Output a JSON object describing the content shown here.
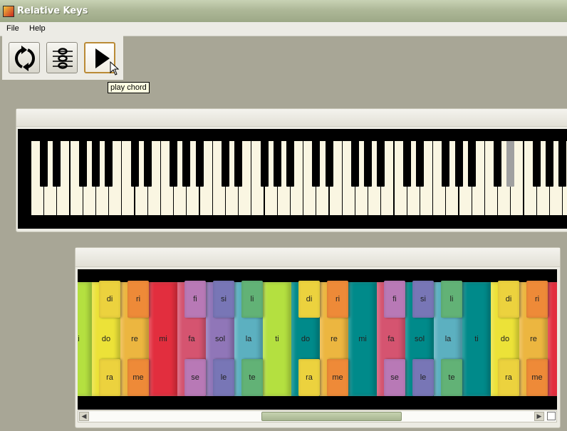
{
  "window": {
    "title": "Relative Keys"
  },
  "menu": {
    "file": "File",
    "help": "Help"
  },
  "toolbar": {
    "refresh_icon": "cycle-arrows-icon",
    "chord_icon": "stacked-notes-icon",
    "play_icon": "play-triangle-icon",
    "tooltip": "play chord"
  },
  "keyboard": {
    "highlighted_white_keys": [
      42
    ],
    "highlighted_black_keys": [
      34,
      36,
      42
    ]
  },
  "solfege": {
    "big": [
      {
        "label": "ti",
        "color": "#b4e040"
      },
      {
        "label": "do",
        "color": "#ece238"
      },
      {
        "label": "re",
        "color": "#ecb640"
      },
      {
        "label": "mi",
        "color": "#e22e3e"
      },
      {
        "label": "fa",
        "color": "#d55470"
      },
      {
        "label": "sol",
        "color": "#9076b8"
      },
      {
        "label": "la",
        "color": "#5cb0c0"
      },
      {
        "label": "ti",
        "color": "#b4e040"
      },
      {
        "label": "do",
        "color": "#008a8a"
      },
      {
        "label": "re",
        "color": "#ecb640"
      },
      {
        "label": "mi",
        "color": "#008a8a"
      },
      {
        "label": "fa",
        "color": "#d55470"
      },
      {
        "label": "sol",
        "color": "#008a8a"
      },
      {
        "label": "la",
        "color": "#5cb0c0"
      },
      {
        "label": "ti",
        "color": "#008a8a"
      },
      {
        "label": "do",
        "color": "#ece238"
      },
      {
        "label": "re",
        "color": "#ecb640"
      },
      {
        "label": "",
        "color": "#e22e3e"
      }
    ],
    "top": [
      {
        "label": "di",
        "color": "#ecd23e"
      },
      {
        "label": "ri",
        "color": "#ee8a38"
      },
      {
        "label": "fi",
        "color": "#b879b6"
      },
      {
        "label": "si",
        "color": "#7876b6"
      },
      {
        "label": "li",
        "color": "#62b276"
      },
      {
        "label": "di",
        "color": "#ecd23e"
      },
      {
        "label": "ri",
        "color": "#ee8a38"
      },
      {
        "label": "fi",
        "color": "#b879b6"
      },
      {
        "label": "si",
        "color": "#7876b6"
      },
      {
        "label": "li",
        "color": "#62b276"
      },
      {
        "label": "di",
        "color": "#ecd23e"
      },
      {
        "label": "ri",
        "color": "#ee8a38"
      }
    ],
    "bottom": [
      {
        "label": "ra",
        "color": "#ecd23e"
      },
      {
        "label": "me",
        "color": "#ee8a38"
      },
      {
        "label": "se",
        "color": "#b879b6"
      },
      {
        "label": "le",
        "color": "#7876b6"
      },
      {
        "label": "te",
        "color": "#62b276"
      },
      {
        "label": "ra",
        "color": "#ecd23e"
      },
      {
        "label": "me",
        "color": "#ee8a38"
      },
      {
        "label": "se",
        "color": "#b879b6"
      },
      {
        "label": "le",
        "color": "#7876b6"
      },
      {
        "label": "te",
        "color": "#62b276"
      },
      {
        "label": "ra",
        "color": "#ecd23e"
      },
      {
        "label": "me",
        "color": "#ee8a38"
      }
    ]
  },
  "scrollbar": {
    "left_icon": "scroll-left-arrow-icon",
    "right_icon": "scroll-right-arrow-icon"
  }
}
